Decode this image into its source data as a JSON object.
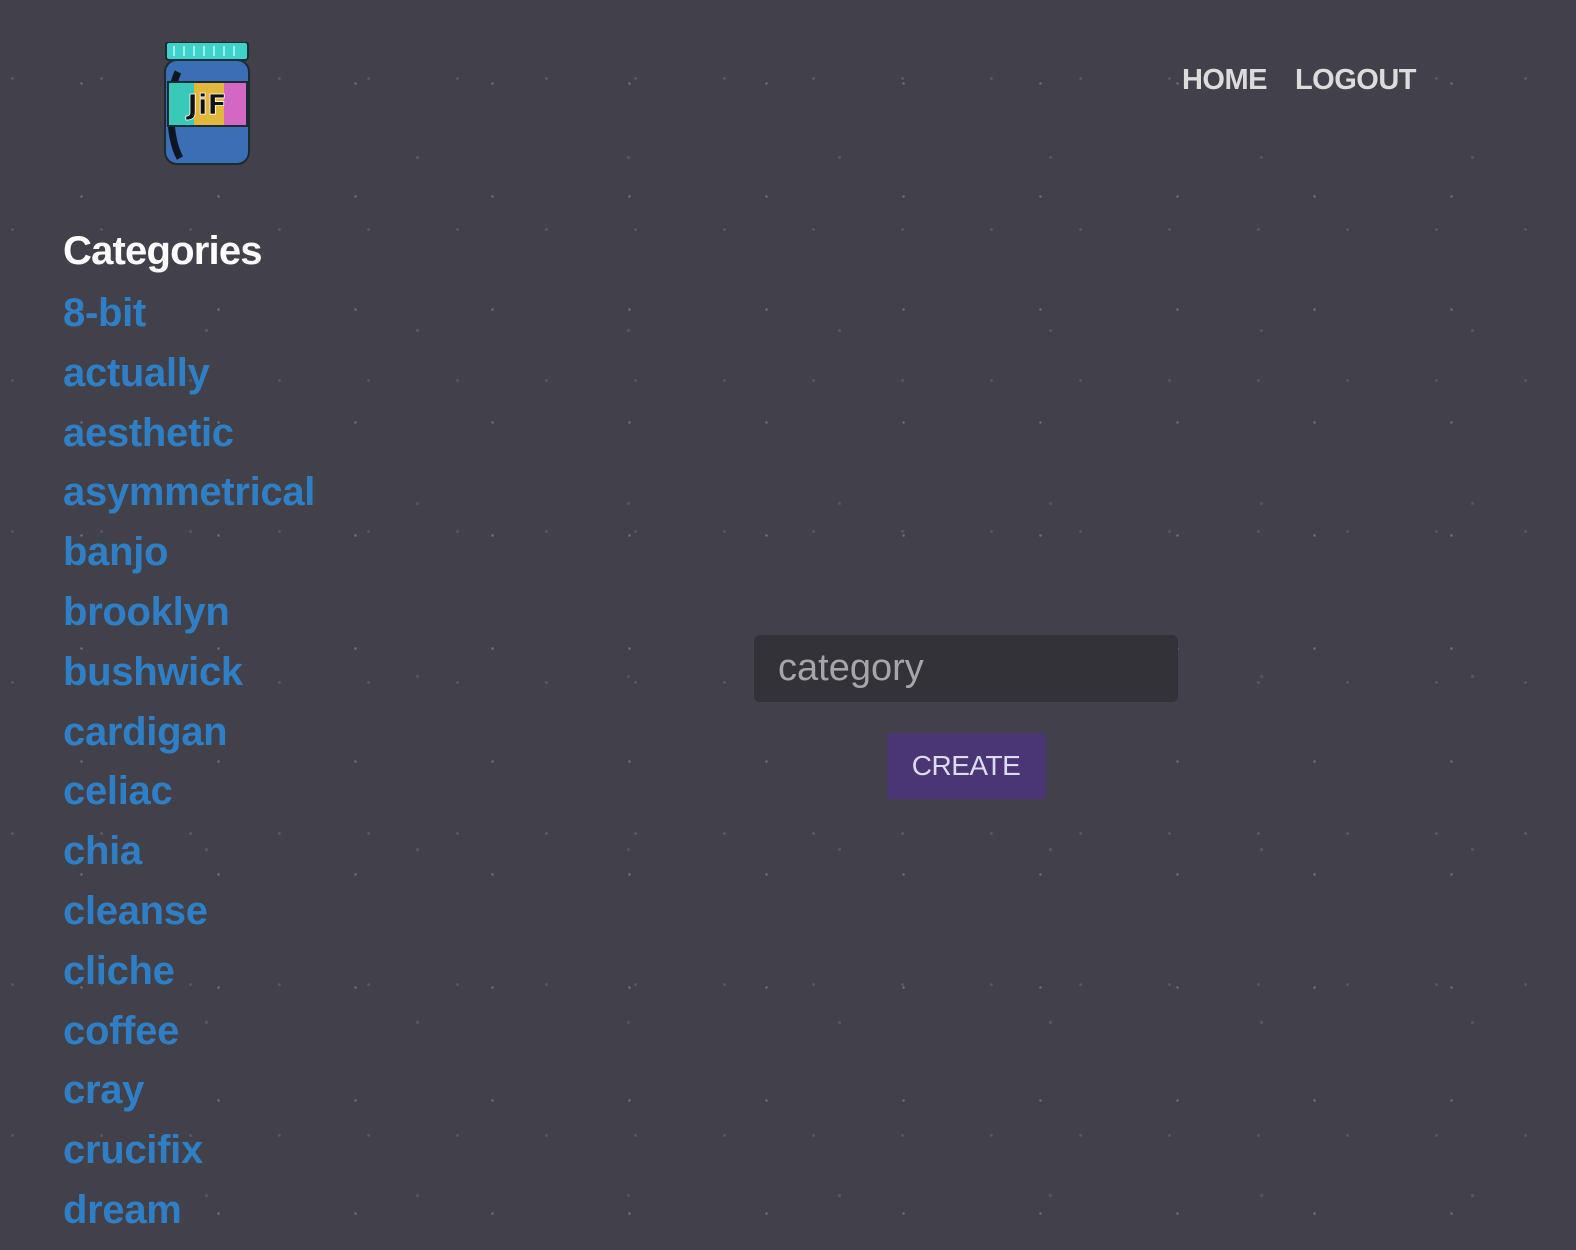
{
  "logo": {
    "icon": "jif-jar-logo-icon",
    "text": "JiF",
    "colors": {
      "lid": "#3ed3c8",
      "jar": "#3a6fb5",
      "label_left": "#38c9b8",
      "label_center": "#e2b73c",
      "label_right": "#d467c4"
    }
  },
  "nav": {
    "home_label": "HOME",
    "logout_label": "LOGOUT"
  },
  "sidebar": {
    "heading": "Categories",
    "items": [
      {
        "label": "8-bit"
      },
      {
        "label": "actually"
      },
      {
        "label": "aesthetic"
      },
      {
        "label": "asymmetrical"
      },
      {
        "label": "banjo"
      },
      {
        "label": "brooklyn"
      },
      {
        "label": "bushwick"
      },
      {
        "label": "cardigan"
      },
      {
        "label": "celiac"
      },
      {
        "label": "chia"
      },
      {
        "label": "cleanse"
      },
      {
        "label": "cliche"
      },
      {
        "label": "coffee"
      },
      {
        "label": "cray"
      },
      {
        "label": "crucifix"
      },
      {
        "label": "dream"
      }
    ]
  },
  "form": {
    "placeholder": "category",
    "value": "",
    "submit_label": "CREATE"
  },
  "colors": {
    "background": "#424149",
    "link": "#2f7fc6",
    "button": "#4a3575",
    "input_bg": "#333238"
  }
}
